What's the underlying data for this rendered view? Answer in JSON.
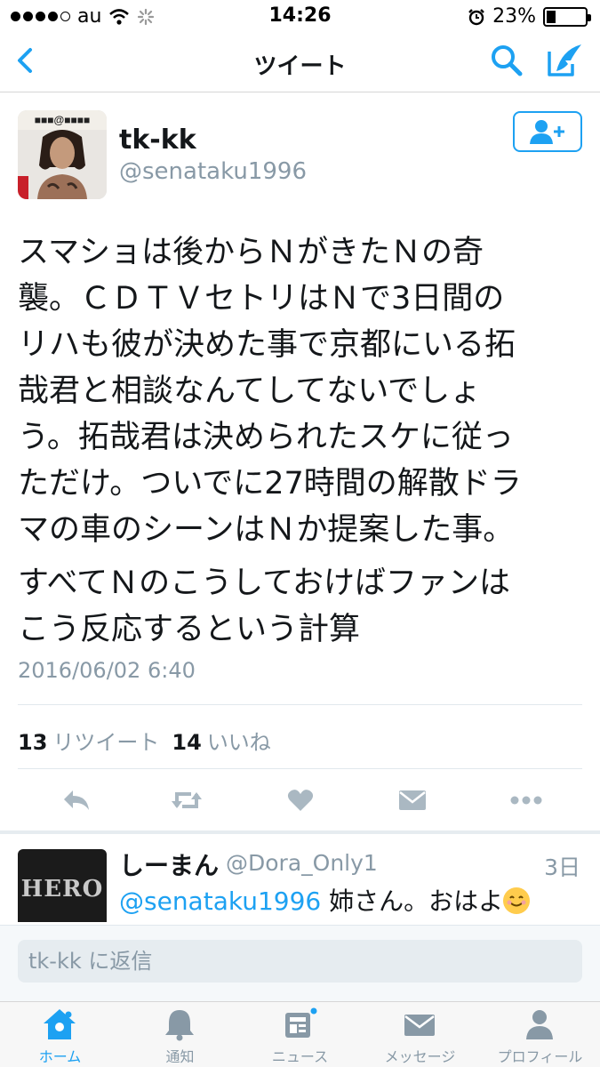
{
  "status_bar": {
    "carrier": "au",
    "time": "14:26",
    "battery": "23%",
    "battery_level": 0.23
  },
  "nav": {
    "title": "ツイート"
  },
  "tweet": {
    "author_name": "tk-kk",
    "author_handle": "@senataku1996",
    "text_lines": [
      "スマショは後からＮがきたＮの奇",
      "襲。ＣＤＴＶセトリはＮで3日間の",
      "リハも彼が決めた事で京都にいる拓",
      "哉君と相談なんてしてないでしょ",
      "う。拓哉君は決められたスケに従っ",
      "ただけ。ついでに27時間の解散ドラ",
      "マの車のシーンはＮか提案した事。",
      "すべてＮのこうしておけばファンは",
      "こう反応するという計算"
    ],
    "date": "2016/06/02 6:40",
    "retweet_count": "13",
    "retweet_label": "リツイート",
    "like_count": "14",
    "like_label": "いいね"
  },
  "reply": {
    "avatar_text": "HERO",
    "name": "しーまん",
    "handle": "@Dora_Only1",
    "time": "3日",
    "mention": "@senataku1996",
    "text": " 姉さん。おはよ",
    "emoji": "smiling-face"
  },
  "reply_bar": {
    "placeholder": "tk-kk に返信"
  },
  "tabs": [
    {
      "label": "ホーム",
      "icon": "home-icon",
      "active": true
    },
    {
      "label": "通知",
      "icon": "bell-icon",
      "active": false
    },
    {
      "label": "ニュース",
      "icon": "news-icon",
      "active": false
    },
    {
      "label": "メッセージ",
      "icon": "mail-icon",
      "active": false
    },
    {
      "label": "プロフィール",
      "icon": "person-icon",
      "active": false
    }
  ],
  "colors": {
    "accent": "#1da1f2",
    "muted": "#8899a6",
    "text": "#14171a"
  }
}
